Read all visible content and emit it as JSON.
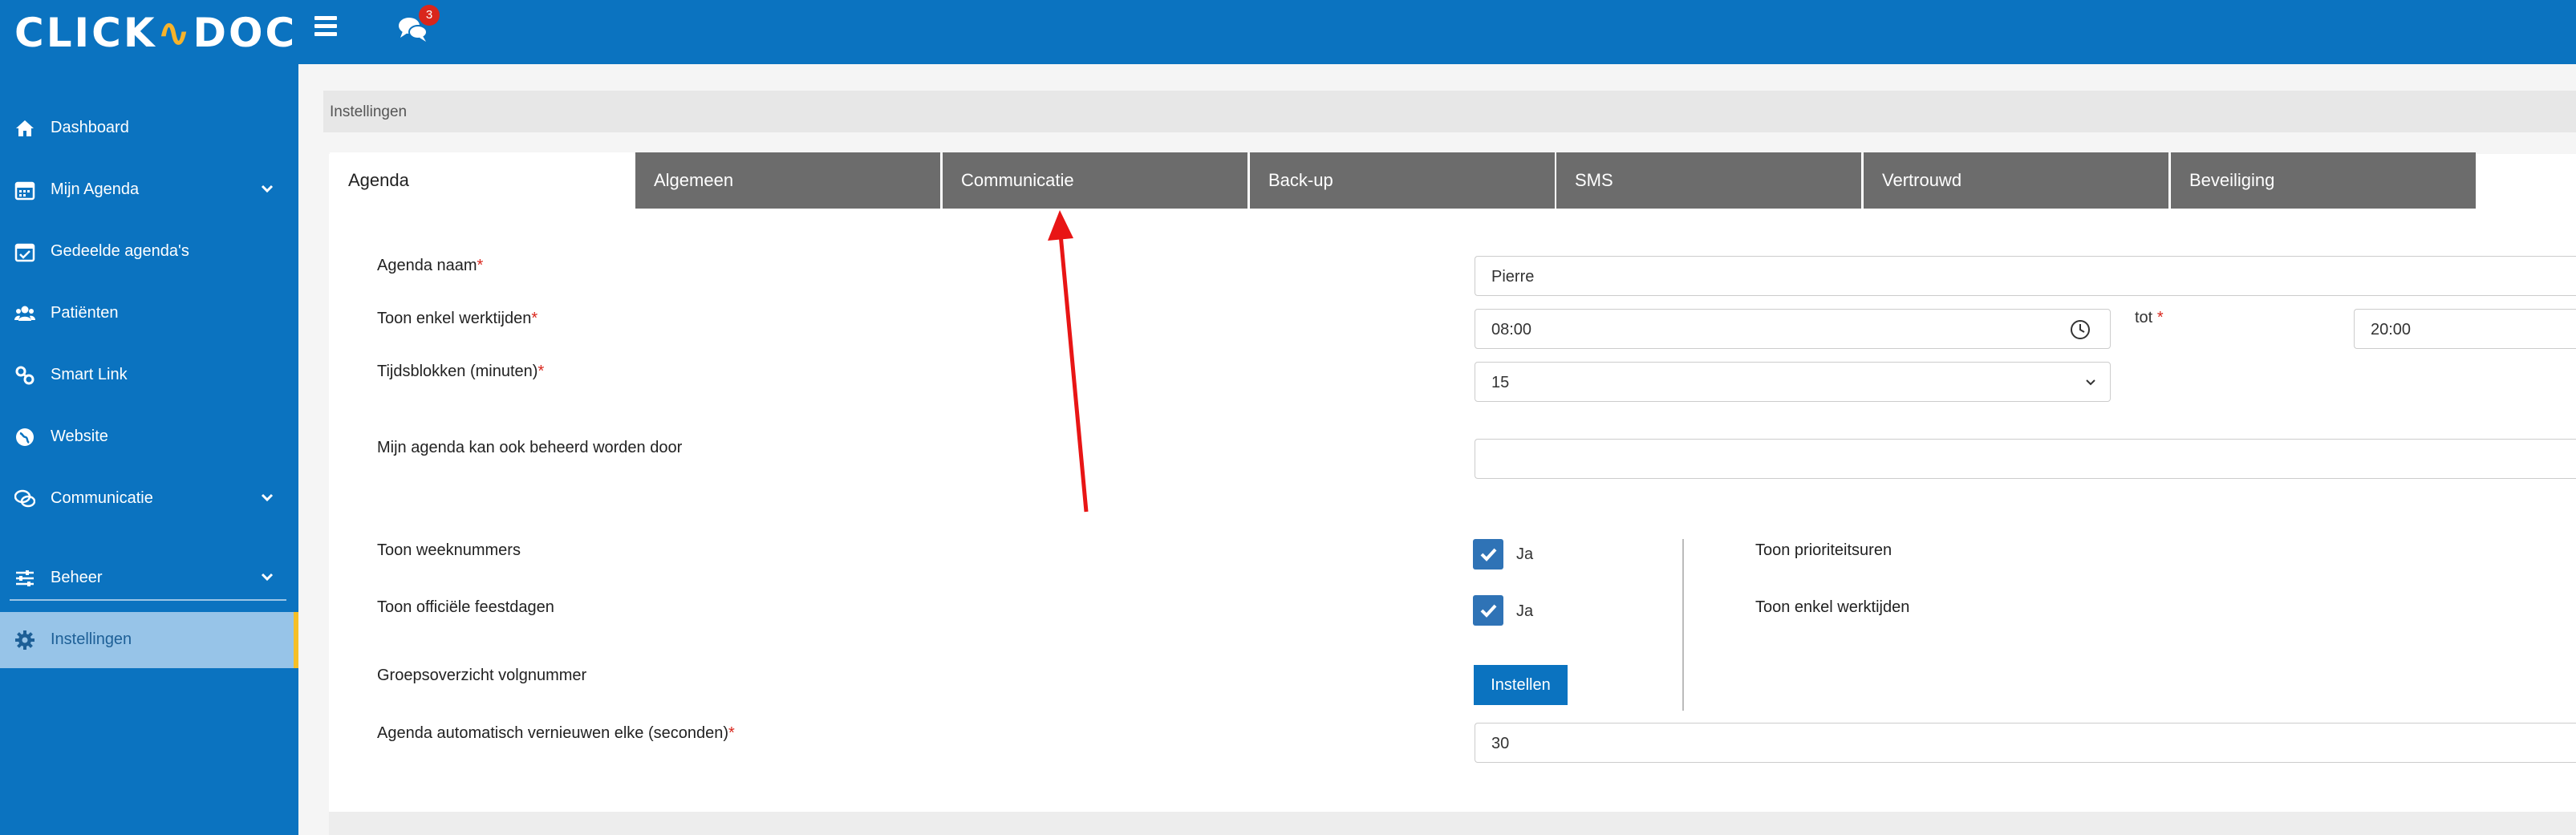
{
  "logo": {
    "text_left": "CLICK",
    "text_right": "DOC"
  },
  "header": {
    "notification_count": "3"
  },
  "sidebar": {
    "items": [
      {
        "label": "Dashboard",
        "icon": "home-icon"
      },
      {
        "label": "Mijn Agenda",
        "icon": "calendar-icon",
        "expandable": true
      },
      {
        "label": "Gedeelde agenda's",
        "icon": "calendar-check-icon"
      },
      {
        "label": "Patiënten",
        "icon": "users-icon"
      },
      {
        "label": "Smart Link",
        "icon": "link-icon"
      },
      {
        "label": "Website",
        "icon": "globe-icon"
      },
      {
        "label": "Communicatie",
        "icon": "chat-icon",
        "expandable": true
      },
      {
        "label": "Beheer",
        "icon": "sliders-icon",
        "expandable": true
      },
      {
        "label": "Instellingen",
        "icon": "gear-icon",
        "active": true
      }
    ]
  },
  "breadcrumb": "Instellingen",
  "tabs": [
    {
      "label": "Agenda",
      "active": true
    },
    {
      "label": "Algemeen"
    },
    {
      "label": "Communicatie"
    },
    {
      "label": "Back-up"
    },
    {
      "label": "SMS"
    },
    {
      "label": "Vertrouwd"
    },
    {
      "label": "Beveiliging"
    }
  ],
  "form": {
    "agenda_naam_label": "Agenda naam",
    "agenda_naam_value": "Pierre",
    "werktijden_label": "Toon enkel werktijden",
    "werktijden_from": "08:00",
    "tot_label": "tot",
    "werktijden_to": "20:00",
    "tijdsblokken_label": "Tijdsblokken (minuten)",
    "tijdsblokken_value": "15",
    "beheerd_label": "Mijn agenda kan ook beheerd worden door",
    "beheerd_value": "",
    "weeknummers_label": "Toon weeknummers",
    "weeknummers_check": "Ja",
    "feestdagen_label": "Toon officiële feestdagen",
    "feestdagen_check": "Ja",
    "prioriteitsuren_label": "Toon prioriteitsuren",
    "enkel_werktijden_label": "Toon enkel werktijden",
    "groepsoverzicht_label": "Groepsoverzicht volgnummer",
    "instellen_button": "Instellen",
    "vernieuwen_label": "Agenda automatisch vernieuwen elke (seconden)",
    "vernieuwen_value": "30",
    "required_mark": "*"
  },
  "colors": {
    "brand_blue": "#0b73c0",
    "active_sidebar": "#97c4e8",
    "accent_yellow": "#f6bf26",
    "tab_gray": "#6c6c6c",
    "annotation_red": "#e81515"
  }
}
